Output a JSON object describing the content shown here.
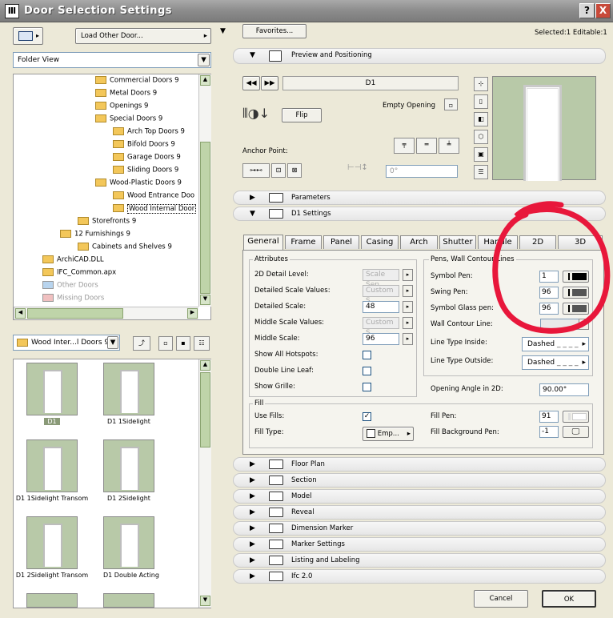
{
  "window": {
    "title": "Door Selection Settings",
    "help": "?",
    "close": "X"
  },
  "left": {
    "load_other": "Load Other Door...",
    "view_select": "Folder View",
    "tree": [
      {
        "label": "Commercial Doors 9",
        "indent": 0
      },
      {
        "label": "Metal Doors 9",
        "indent": 0
      },
      {
        "label": "Openings 9",
        "indent": 0
      },
      {
        "label": "Special Doors 9",
        "indent": 0
      },
      {
        "label": "Arch Top Doors 9",
        "indent": 1
      },
      {
        "label": "Bifold Doors 9",
        "indent": 1
      },
      {
        "label": "Garage Doors 9",
        "indent": 1
      },
      {
        "label": "Sliding Doors 9",
        "indent": 1
      },
      {
        "label": "Wood-Plastic Doors 9",
        "indent": 0
      },
      {
        "label": "Wood Entrance Doo",
        "indent": 1
      },
      {
        "label": "Wood Internal Door",
        "indent": 1
      },
      {
        "label": "Storefronts 9",
        "indent": -1
      },
      {
        "label": "12 Furnishings 9",
        "indent": -2
      },
      {
        "label": "Cabinets and Shelves 9",
        "indent": -1
      },
      {
        "label": "ArchiCAD.DLL",
        "indent": -3
      },
      {
        "label": "IFC_Common.apx",
        "indent": -3
      },
      {
        "label": "Other Doors",
        "indent": -3
      },
      {
        "label": "Missing Doors",
        "indent": -3
      }
    ],
    "folder_select": "Wood Inter...l Doors 9",
    "thumbs": [
      "D1",
      "D1 1Sidelight",
      "D1 1Sidelight Transom",
      "D1 2Sidelight",
      "D1 2Sidelight Transom",
      "D1 Double Acting"
    ]
  },
  "right": {
    "favorites": "Favorites...",
    "selected": "Selected:1 Editable:1",
    "preview_section": "Preview and Positioning",
    "door_name": "D1",
    "empty_opening": "Empty Opening",
    "flip": "Flip",
    "anchor_point": "Anchor Point:",
    "angle": "0°",
    "parameters": "Parameters",
    "d1_settings": "D1 Settings",
    "tabs": [
      "General",
      "Frame",
      "Panel",
      "Casing",
      "Arch",
      "Shutter",
      "Handle",
      "2D",
      "3D"
    ],
    "attributes_title": "Attributes",
    "attributes": [
      {
        "label": "2D Detail Level:",
        "value": "Scale Sen",
        "dim": true,
        "kind": "select"
      },
      {
        "label": "Detailed Scale Values:",
        "value": "Custom S",
        "dim": true,
        "kind": "select"
      },
      {
        "label": "Detailed Scale:",
        "value": "48",
        "dim": false,
        "kind": "select"
      },
      {
        "label": "Middle Scale Values:",
        "value": "Custom S",
        "dim": true,
        "kind": "select"
      },
      {
        "label": "Middle Scale:",
        "value": "96",
        "dim": false,
        "kind": "select"
      },
      {
        "label": "Show All Hotspots:",
        "value": "",
        "kind": "check"
      },
      {
        "label": "Double Line Leaf:",
        "value": "",
        "kind": "check"
      },
      {
        "label": "Show Grille:",
        "value": "",
        "kind": "check"
      }
    ],
    "pens_title": "Pens, Wall Contour Lines",
    "pens": [
      {
        "label": "Symbol Pen:",
        "value": "1"
      },
      {
        "label": "Swing Pen:",
        "value": "96"
      },
      {
        "label": "Symbol Glass pen:",
        "value": "96"
      }
    ],
    "wall_contour": "Wall Contour Line:",
    "line_inside_label": "Line Type Inside:",
    "line_inside": "Dashed",
    "line_outside_label": "Line Type Outside:",
    "line_outside": "Dashed",
    "opening_angle_label": "Opening Angle in 2D:",
    "opening_angle": "90.00°",
    "fill_title": "Fill",
    "use_fills": "Use Fills:",
    "fill_type": "Fill Type:",
    "fill_type_value": "Emp...",
    "fill_pen_label": "Fill Pen:",
    "fill_pen": "91",
    "fill_bg_label": "Fill Background Pen:",
    "fill_bg": "-1",
    "sections": [
      "Floor Plan",
      "Section",
      "Model",
      "Reveal",
      "Dimension Marker",
      "Marker Settings",
      "Listing and Labeling",
      "Ifc 2.0"
    ],
    "cancel": "Cancel",
    "ok": "OK"
  },
  "colors": {
    "annotation": "#e8173b",
    "preview_bg": "#b8c9a8"
  }
}
